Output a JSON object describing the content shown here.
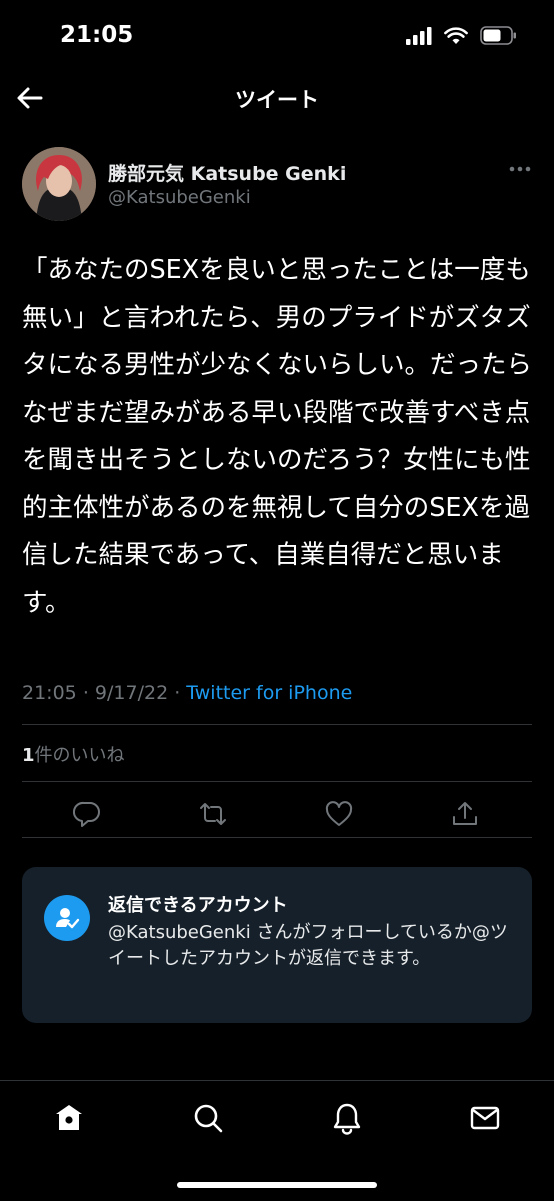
{
  "status_bar": {
    "time": "21:05"
  },
  "nav": {
    "title": "ツイート"
  },
  "author": {
    "name": "勝部元気 Katsube Genki",
    "handle": "@KatsubeGenki"
  },
  "tweet": {
    "text": "「あなたのSEXを良いと思ったことは一度も無い」と言われたら、男のプライドがズタズタになる男性が少なくないらしい。だったらなぜまだ望みがある早い段階で改善すべき点を聞き出そうとしないのだろう？女性にも性的主体性があるのを無視して自分のSEXを過信した結果であって、自業自得だと思います。",
    "time": "21:05",
    "date": "9/17/22",
    "separator": "·",
    "source": "Twitter for iPhone"
  },
  "likes": {
    "count": "1",
    "label": "件のいいね"
  },
  "reply_info": {
    "title": "返信できるアカウント",
    "body": "@KatsubeGenki さんがフォローしているか@ツイートしたアカウントが返信できます。"
  },
  "tabbar": {
    "items": [
      "home-icon",
      "search-icon",
      "notifications-icon",
      "messages-icon"
    ]
  },
  "colors": {
    "accent": "#1d9bf0",
    "background": "#000000",
    "muted": "#71767b",
    "card": "#16202a"
  }
}
